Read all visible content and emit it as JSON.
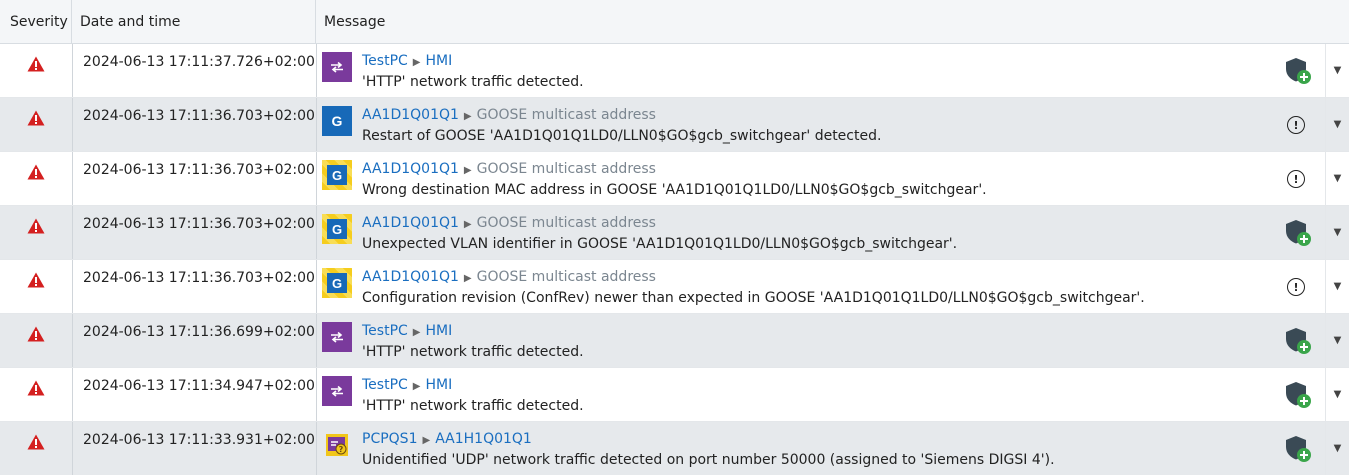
{
  "header": {
    "severity": "Severity",
    "date_time": "Date and time",
    "message": "Message"
  },
  "colors": {
    "alert_red": "#d42020",
    "link_blue": "#1a6ec0",
    "purple_icon": "#7a3a9c",
    "blue_icon": "#1769b8",
    "shield_grey": "#3a4a55",
    "plus_green": "#3aa54a"
  },
  "rows": [
    {
      "severity_icon": "warning-triangle-icon",
      "timestamp": "2024-06-13 17:11:37.726+02:00",
      "type_icon": "http-traffic-icon",
      "source": "TestPC",
      "destination": "HMI",
      "destination_style": "link",
      "message": "'HTTP' network traffic detected.",
      "action_icon": "shield-add-icon"
    },
    {
      "severity_icon": "warning-triangle-icon",
      "timestamp": "2024-06-13 17:11:36.703+02:00",
      "type_icon": "goose-icon",
      "type_label": "G",
      "source": "AA1D1Q01Q1",
      "destination": "GOOSE multicast address",
      "destination_style": "grey",
      "message": "Restart of GOOSE 'AA1D1Q01Q1LD0/LLN0$GO$gcb_switchgear' detected.",
      "action_icon": "info-circle-icon"
    },
    {
      "severity_icon": "warning-triangle-icon",
      "timestamp": "2024-06-13 17:11:36.703+02:00",
      "type_icon": "goose-warning-icon",
      "type_label": "G",
      "source": "AA1D1Q01Q1",
      "destination": "GOOSE multicast address",
      "destination_style": "grey",
      "message": "Wrong destination MAC address in GOOSE 'AA1D1Q01Q1LD0/LLN0$GO$gcb_switchgear'.",
      "action_icon": "info-circle-icon"
    },
    {
      "severity_icon": "warning-triangle-icon",
      "timestamp": "2024-06-13 17:11:36.703+02:00",
      "type_icon": "goose-warning-icon",
      "type_label": "G",
      "source": "AA1D1Q01Q1",
      "destination": "GOOSE multicast address",
      "destination_style": "grey",
      "message": "Unexpected VLAN identifier in GOOSE 'AA1D1Q01Q1LD0/LLN0$GO$gcb_switchgear'.",
      "action_icon": "shield-add-icon"
    },
    {
      "severity_icon": "warning-triangle-icon",
      "timestamp": "2024-06-13 17:11:36.703+02:00",
      "type_icon": "goose-warning-icon",
      "type_label": "G",
      "source": "AA1D1Q01Q1",
      "destination": "GOOSE multicast address",
      "destination_style": "grey",
      "message": "Configuration revision (ConfRev) newer than expected in GOOSE 'AA1D1Q01Q1LD0/LLN0$GO$gcb_switchgear'.",
      "action_icon": "info-circle-icon"
    },
    {
      "severity_icon": "warning-triangle-icon",
      "timestamp": "2024-06-13 17:11:36.699+02:00",
      "type_icon": "http-traffic-icon",
      "source": "TestPC",
      "destination": "HMI",
      "destination_style": "link",
      "message": "'HTTP' network traffic detected.",
      "action_icon": "shield-add-icon"
    },
    {
      "severity_icon": "warning-triangle-icon",
      "timestamp": "2024-06-13 17:11:34.947+02:00",
      "type_icon": "http-traffic-icon",
      "source": "TestPC",
      "destination": "HMI",
      "destination_style": "link",
      "message": "'HTTP' network traffic detected.",
      "action_icon": "shield-add-icon"
    },
    {
      "severity_icon": "warning-triangle-icon",
      "timestamp": "2024-06-13 17:11:33.931+02:00",
      "type_icon": "unidentified-traffic-icon",
      "source": "PCPQS1",
      "destination": "AA1H1Q01Q1",
      "destination_style": "link",
      "message": "Unidentified 'UDP' network traffic detected on port number 50000 (assigned to 'Siemens DIGSI 4').",
      "action_icon": "shield-add-icon"
    }
  ]
}
